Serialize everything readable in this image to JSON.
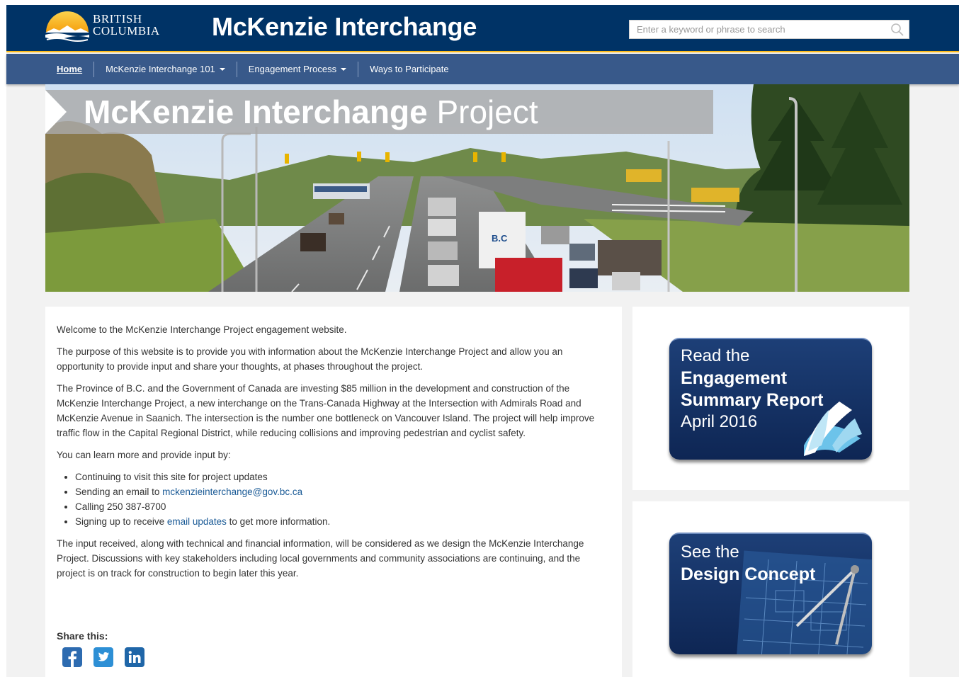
{
  "header": {
    "logo": {
      "line1": "BRITISH",
      "line2": "COLUMBIA"
    },
    "site_title": "McKenzie Interchange",
    "search": {
      "placeholder": "Enter a keyword or phrase to search",
      "value": ""
    }
  },
  "nav": {
    "items": [
      {
        "label": "Home",
        "active": true,
        "has_dropdown": false
      },
      {
        "label": "McKenzie Interchange 101",
        "active": false,
        "has_dropdown": true
      },
      {
        "label": "Engagement Process",
        "active": false,
        "has_dropdown": true
      },
      {
        "label": "Ways to Participate",
        "active": false,
        "has_dropdown": false
      }
    ]
  },
  "banner": {
    "title_bold": "McKenzie Interchange",
    "title_light": "Project"
  },
  "content": {
    "welcome": "Welcome to the McKenzie Interchange Project engagement website.",
    "purpose": "The purpose of this website is to provide you with information about the McKenzie Interchange Project and allow you an opportunity to provide input and share your thoughts, at phases throughout the project.",
    "investment": "The Province of B.C. and the Government of Canada are investing $85 million in the development and construction of the McKenzie Interchange Project, a new interchange on the Trans-Canada Highway at the Intersection with Admirals Road and McKenzie Avenue in Saanich. The intersection is the number one bottleneck on Vancouver Island. The project will help improve traffic flow in the Capital Regional District, while reducing collisions and improving pedestrian and cyclist safety.",
    "learn_more": "You can learn more and provide input by:",
    "bullets": {
      "b1": "Continuing to visit this site for project updates",
      "b2_prefix": "Sending an email to ",
      "b2_link": "mckenzieinterchange@gov.bc.ca",
      "b3": "Calling 250 387-8700",
      "b4_prefix": "Signing up to receive ",
      "b4_link": "email updates",
      "b4_suffix": " to get more information."
    },
    "closing": "The input received, along with technical and financial information, will be considered as we design the McKenzie Interchange Project. Discussions with key stakeholders including local governments and community associations are continuing, and the project is on track for construction to begin later this year.",
    "share_label": "Share this:",
    "share_icons": [
      "facebook-icon",
      "twitter-icon",
      "linkedin-icon"
    ]
  },
  "sidebar": {
    "report_card": {
      "line1": "Read the",
      "line2": "Engagement",
      "line3": "Summary Report",
      "line4": "April 2016"
    },
    "design_card": {
      "line1": "See the",
      "line2": "Design Concept"
    }
  },
  "colors": {
    "header_bg": "#003366",
    "nav_bg": "#38598a",
    "accent_gold": "#fcba19",
    "link": "#1a5a96",
    "promo_bg": "#13306a"
  }
}
